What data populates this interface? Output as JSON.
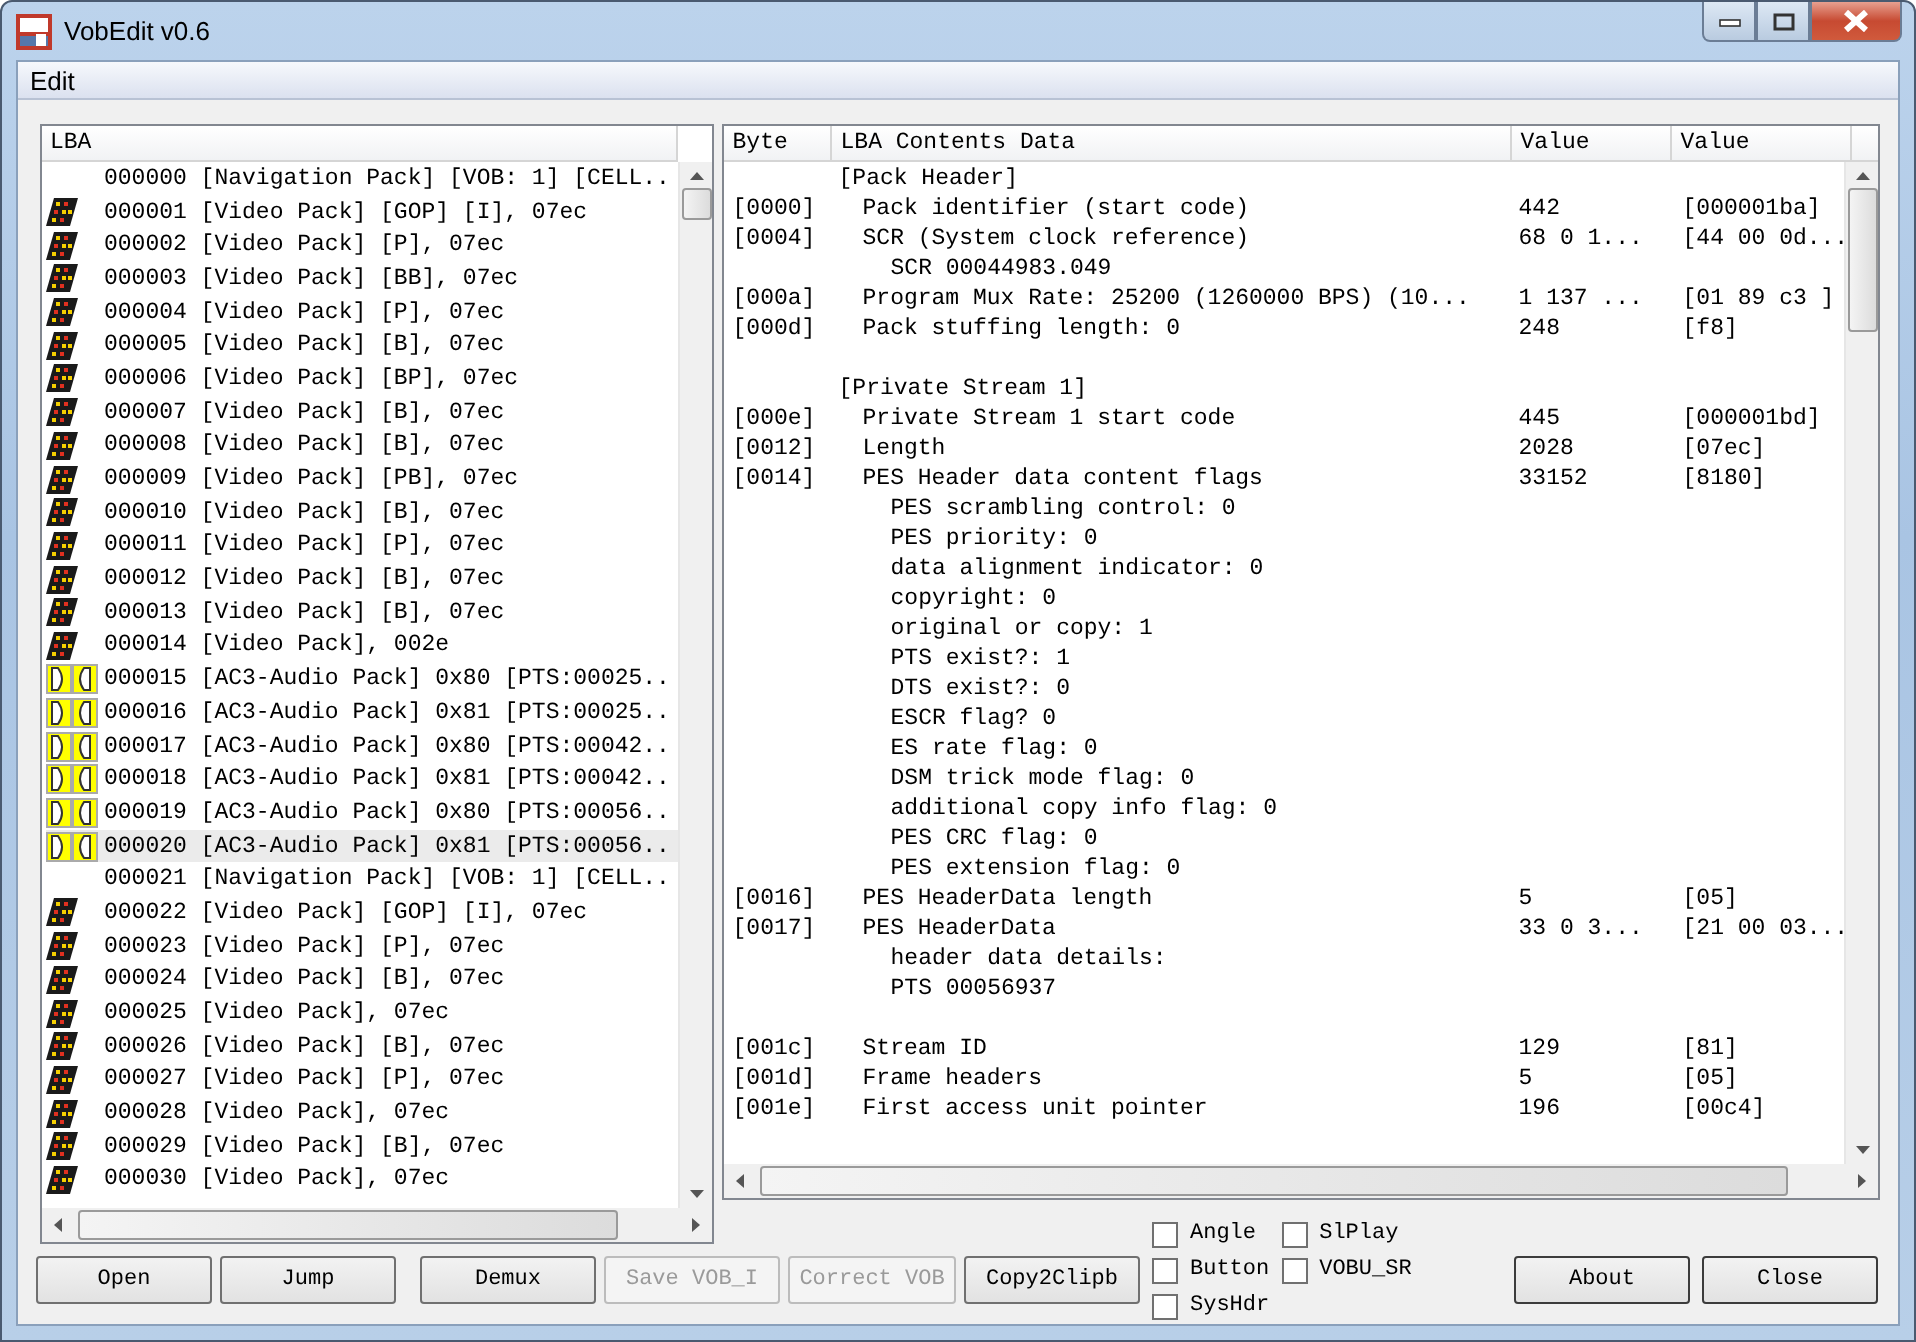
{
  "window": {
    "title": "VobEdit v0.6"
  },
  "menu": [
    {
      "label": "Edit"
    }
  ],
  "lba_list": {
    "header": "LBA",
    "items": [
      {
        "kind": "nav",
        "text": "000000 [Navigation Pack] [VOB: 1] [CELL..",
        "selected": false
      },
      {
        "kind": "video",
        "text": "000001 [Video Pack] [GOP] [I], 07ec",
        "selected": false
      },
      {
        "kind": "video",
        "text": "000002 [Video Pack] [P], 07ec",
        "selected": false
      },
      {
        "kind": "video",
        "text": "000003 [Video Pack] [BB], 07ec",
        "selected": false
      },
      {
        "kind": "video",
        "text": "000004 [Video Pack] [P], 07ec",
        "selected": false
      },
      {
        "kind": "video",
        "text": "000005 [Video Pack] [B], 07ec",
        "selected": false
      },
      {
        "kind": "video",
        "text": "000006 [Video Pack] [BP], 07ec",
        "selected": false
      },
      {
        "kind": "video",
        "text": "000007 [Video Pack] [B], 07ec",
        "selected": false
      },
      {
        "kind": "video",
        "text": "000008 [Video Pack] [B], 07ec",
        "selected": false
      },
      {
        "kind": "video",
        "text": "000009 [Video Pack] [PB], 07ec",
        "selected": false
      },
      {
        "kind": "video",
        "text": "000010 [Video Pack] [B], 07ec",
        "selected": false
      },
      {
        "kind": "video",
        "text": "000011 [Video Pack] [P], 07ec",
        "selected": false
      },
      {
        "kind": "video",
        "text": "000012 [Video Pack] [B], 07ec",
        "selected": false
      },
      {
        "kind": "video",
        "text": "000013 [Video Pack] [B], 07ec",
        "selected": false
      },
      {
        "kind": "video",
        "text": "000014 [Video Pack], 002e",
        "selected": false
      },
      {
        "kind": "audio",
        "text": "000015 [AC3-Audio Pack] 0x80 [PTS:00025..",
        "selected": false
      },
      {
        "kind": "audio",
        "text": "000016 [AC3-Audio Pack] 0x81 [PTS:00025..",
        "selected": false
      },
      {
        "kind": "audio",
        "text": "000017 [AC3-Audio Pack] 0x80 [PTS:00042..",
        "selected": false
      },
      {
        "kind": "audio",
        "text": "000018 [AC3-Audio Pack] 0x81 [PTS:00042..",
        "selected": false
      },
      {
        "kind": "audio",
        "text": "000019 [AC3-Audio Pack] 0x80 [PTS:00056..",
        "selected": false
      },
      {
        "kind": "audio",
        "text": "000020 [AC3-Audio Pack] 0x81 [PTS:00056..",
        "selected": true
      },
      {
        "kind": "nav",
        "text": "000021 [Navigation Pack] [VOB: 1] [CELL..",
        "selected": false
      },
      {
        "kind": "video",
        "text": "000022 [Video Pack] [GOP] [I], 07ec",
        "selected": false
      },
      {
        "kind": "video",
        "text": "000023 [Video Pack] [P], 07ec",
        "selected": false
      },
      {
        "kind": "video",
        "text": "000024 [Video Pack] [B], 07ec",
        "selected": false
      },
      {
        "kind": "video",
        "text": "000025 [Video Pack], 07ec",
        "selected": false
      },
      {
        "kind": "video",
        "text": "000026 [Video Pack] [B], 07ec",
        "selected": false
      },
      {
        "kind": "video",
        "text": "000027 [Video Pack] [P], 07ec",
        "selected": false
      },
      {
        "kind": "video",
        "text": "000028 [Video Pack], 07ec",
        "selected": false
      },
      {
        "kind": "video",
        "text": "000029 [Video Pack] [B], 07ec",
        "selected": false
      },
      {
        "kind": "video",
        "text": "000030 [Video Pack], 07ec",
        "selected": false
      }
    ]
  },
  "detail_table": {
    "columns": [
      "Byte",
      "LBA Contents Data",
      "Value",
      "Value"
    ],
    "sections": [
      {
        "title": "[Pack Header]",
        "fields": [
          {
            "byte": "[0000]",
            "label": "Pack identifier (start code)",
            "value": "442",
            "value_hex": "[000001ba]"
          },
          {
            "byte": "[0004]",
            "label": "SCR (System clock reference)",
            "value": "68 0 1...",
            "value_hex": "[44 00 0d...",
            "children": [
              {
                "label": "SCR 00044983.049"
              }
            ]
          },
          {
            "byte": "[000a]",
            "label": "Program Mux Rate: 25200 (1260000 BPS) (10...",
            "value": "1 137 ...",
            "value_hex": "[01 89 c3 ]"
          },
          {
            "byte": "[000d]",
            "label": "Pack stuffing length: 0",
            "value": "248",
            "value_hex": "[f8]"
          }
        ]
      },
      {
        "title": "[Private Stream 1]",
        "fields": [
          {
            "byte": "[000e]",
            "label": "Private Stream 1 start code",
            "value": "445",
            "value_hex": "[000001bd]"
          },
          {
            "byte": "[0012]",
            "label": "Length",
            "value": "2028",
            "value_hex": "[07ec]"
          },
          {
            "byte": "[0014]",
            "label": "PES Header data content flags",
            "value": "33152",
            "value_hex": "[8180]",
            "children": [
              {
                "label": "PES scrambling control: 0"
              },
              {
                "label": "PES priority: 0"
              },
              {
                "label": "data alignment indicator: 0"
              },
              {
                "label": "copyright: 0"
              },
              {
                "label": "original or copy: 1"
              },
              {
                "label": "PTS exist?: 1"
              },
              {
                "label": "DTS exist?: 0"
              },
              {
                "label": "ESCR flag? 0"
              },
              {
                "label": "ES rate flag: 0"
              },
              {
                "label": "DSM trick mode flag: 0"
              },
              {
                "label": "additional copy info flag: 0"
              },
              {
                "label": "PES CRC flag: 0"
              },
              {
                "label": "PES extension flag: 0"
              }
            ]
          },
          {
            "byte": "[0016]",
            "label": "PES HeaderData length",
            "value": "5",
            "value_hex": "[05]"
          },
          {
            "byte": "[0017]",
            "label": "PES HeaderData",
            "value": "33 0 3...",
            "value_hex": "[21 00 03...",
            "children": [
              {
                "label": "header data details:",
                "children": [
                  {
                    "label": "PTS 00056937"
                  }
                ]
              }
            ]
          }
        ]
      },
      {
        "fields": [
          {
            "byte": "[001c]",
            "label": "Stream ID",
            "value": "129",
            "value_hex": "[81]"
          },
          {
            "byte": "[001d]",
            "label": "Frame headers",
            "value": "5",
            "value_hex": "[05]"
          },
          {
            "byte": "[001e]",
            "label": "First access unit pointer",
            "value": "196",
            "value_hex": "[00c4]"
          }
        ]
      }
    ]
  },
  "buttons_left": [
    {
      "label": "Open",
      "disabled": false
    },
    {
      "label": "Jump",
      "disabled": false
    },
    {
      "label": "Demux",
      "disabled": false
    },
    {
      "label": "Save VOB_I",
      "disabled": true
    },
    {
      "label": "Correct VOB",
      "disabled": true
    },
    {
      "label": "Copy2Clipb",
      "disabled": false
    }
  ],
  "options": [
    [
      {
        "label": "Angle",
        "checked": false
      },
      {
        "label": "Button",
        "checked": false
      },
      {
        "label": "SysHdr",
        "checked": false
      }
    ],
    [
      {
        "label": "SlPlay",
        "checked": false
      },
      {
        "label": "VOBU_SR",
        "checked": false
      }
    ]
  ],
  "buttons_right": [
    {
      "label": "About",
      "disabled": false
    },
    {
      "label": "Close",
      "disabled": false
    }
  ]
}
